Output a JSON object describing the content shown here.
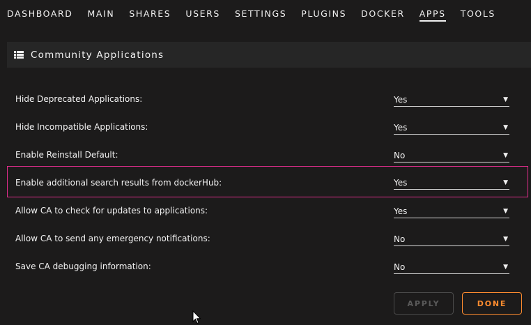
{
  "nav": {
    "items": [
      {
        "label": "DASHBOARD"
      },
      {
        "label": "MAIN"
      },
      {
        "label": "SHARES"
      },
      {
        "label": "USERS"
      },
      {
        "label": "SETTINGS"
      },
      {
        "label": "PLUGINS"
      },
      {
        "label": "DOCKER"
      },
      {
        "label": "APPS",
        "active": true
      },
      {
        "label": "TOOLS"
      }
    ]
  },
  "section": {
    "title": "Community Applications",
    "icon": "grid-icon"
  },
  "settings": [
    {
      "label": "Hide Deprecated Applications:",
      "value": "Yes"
    },
    {
      "label": "Hide Incompatible Applications:",
      "value": "Yes"
    },
    {
      "label": "Enable Reinstall Default:",
      "value": "No"
    },
    {
      "label": "Enable additional search results from dockerHub:",
      "value": "Yes",
      "highlighted": true
    },
    {
      "label": "Allow CA to check for updates to applications:",
      "value": "Yes"
    },
    {
      "label": "Allow CA to send any emergency notifications:",
      "value": "No"
    },
    {
      "label": "Save CA debugging information:",
      "value": "No"
    }
  ],
  "buttons": {
    "apply_label": "APPLY",
    "done_label": "DONE"
  },
  "colors": {
    "background": "#1c1b1b",
    "highlight_border": "#e22d8c",
    "done_accent": "#ff8c2f"
  }
}
